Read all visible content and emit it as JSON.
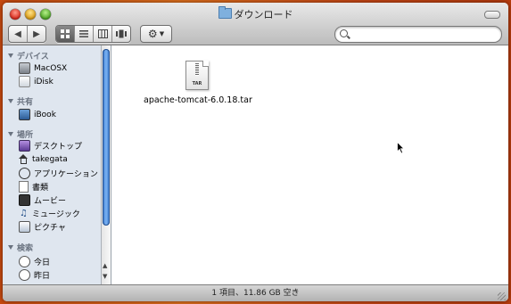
{
  "window": {
    "title": "ダウンロード"
  },
  "toolbar": {
    "back_icon": "back-arrow-icon",
    "forward_icon": "forward-arrow-icon",
    "views": [
      "icon-view",
      "list-view",
      "column-view",
      "coverflow-view"
    ],
    "active_view": "icon-view",
    "action_icon": "gear-icon",
    "search_placeholder": ""
  },
  "sidebar": {
    "sections": [
      {
        "label": "デバイス",
        "items": [
          {
            "label": "MacOSX",
            "icon": "hard-disk-icon"
          },
          {
            "label": "iDisk",
            "icon": "idisk-icon"
          }
        ]
      },
      {
        "label": "共有",
        "items": [
          {
            "label": "iBook",
            "icon": "laptop-icon"
          }
        ]
      },
      {
        "label": "場所",
        "items": [
          {
            "label": "デスクトップ",
            "icon": "desktop-icon"
          },
          {
            "label": "takegata",
            "icon": "home-icon"
          },
          {
            "label": "アプリケーション",
            "icon": "applications-icon"
          },
          {
            "label": "書類",
            "icon": "documents-icon"
          },
          {
            "label": "ムービー",
            "icon": "movies-icon"
          },
          {
            "label": "ミュージック",
            "icon": "music-icon"
          },
          {
            "label": "ピクチャ",
            "icon": "pictures-icon"
          }
        ]
      },
      {
        "label": "検索",
        "items": [
          {
            "label": "今日",
            "icon": "clock-icon"
          },
          {
            "label": "昨日",
            "icon": "clock-icon"
          }
        ]
      }
    ]
  },
  "content": {
    "files": [
      {
        "name": "apache-tomcat-6.0.18.tar",
        "icon": "tar-archive-icon",
        "badge": "TAR"
      }
    ]
  },
  "status": {
    "text": "1 項目、11.86 GB 空き"
  }
}
